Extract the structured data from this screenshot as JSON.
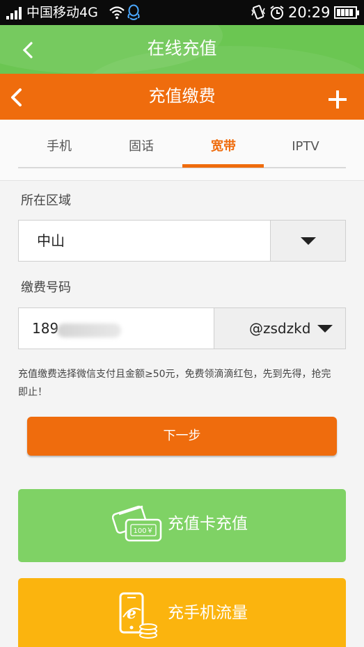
{
  "status_bar": {
    "carrier": "中国移动4G",
    "time": "20:29"
  },
  "outer_header": {
    "title": "在线充值"
  },
  "inner_header": {
    "title": "充值缴费"
  },
  "tabs": [
    {
      "label": "手机",
      "active": false
    },
    {
      "label": "固话",
      "active": false
    },
    {
      "label": "宽带",
      "active": true
    },
    {
      "label": "IPTV",
      "active": false
    }
  ],
  "form": {
    "region_label": "所在区域",
    "region_value": "中山",
    "number_label": "缴费号码",
    "number_value": "189",
    "number_suffix": "@zsdzkd",
    "notice": "充值缴费选择微信支付且金额≥50元，免费领滴滴红包，先到先得，抢完即止！",
    "next_button": "下一步"
  },
  "actions": {
    "card_recharge": "充值卡充值",
    "card_amount": "100￥",
    "data_recharge": "充手机流量"
  },
  "colors": {
    "green": "#6bc652",
    "orange": "#ef6c0d",
    "light_green": "#7fd265",
    "yellow": "#fbb40e"
  }
}
